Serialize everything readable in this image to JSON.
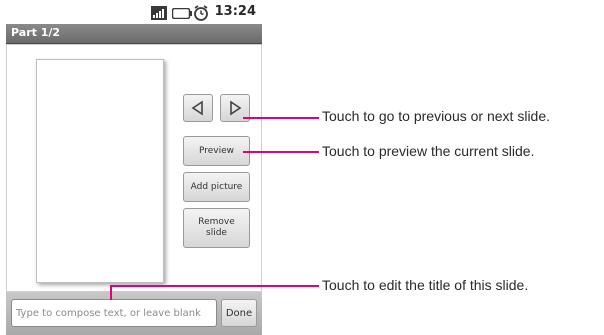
{
  "status_bar": {
    "time": "13:24",
    "icons": [
      "signal-icon",
      "battery-icon",
      "alarm-icon"
    ]
  },
  "title_bar": {
    "title": "Part 1/2"
  },
  "buttons": {
    "previous_icon": "previous-arrow-icon",
    "next_icon": "next-arrow-icon",
    "preview": "Preview",
    "add_picture": "Add picture",
    "remove_slide_line1": "Remove",
    "remove_slide_line2": "slide",
    "done": "Done"
  },
  "compose": {
    "placeholder": "Type to compose text, or leave blank",
    "value": ""
  },
  "callouts": [
    {
      "text": "Touch to go to previous or next slide."
    },
    {
      "text": "Touch to preview the current slide."
    },
    {
      "text": "Touch to edit the title of this slide."
    }
  ],
  "colors": {
    "callout_line": "#e0007a",
    "title_bar": "#7a7a7a",
    "bottom_bar": "#b8b8b8"
  }
}
